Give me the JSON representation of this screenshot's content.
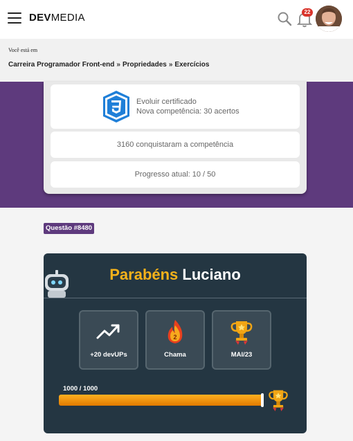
{
  "header": {
    "logo_bold": "DEV",
    "logo_light": "MEDIA",
    "notifications_count": "22"
  },
  "breadcrumb": {
    "label": "Você está em",
    "items": [
      "Carreira Programador Front-end",
      "Propriedades",
      "Exercícios"
    ],
    "separator": "»"
  },
  "competency": {
    "line1": "Evoluir certificado",
    "line2": "Nova competência: 30 acertos",
    "achievers": "3160 conquistaram a competência",
    "progress": "Progresso atual: 10 / 50"
  },
  "question": {
    "tag": "Questão #8480"
  },
  "congrats": {
    "word": "Parabéns",
    "name": "Luciano",
    "stats": [
      {
        "label": "+20 devUPs",
        "icon": "trending-up-icon"
      },
      {
        "label": "Chama",
        "icon": "flame-icon",
        "value": "2"
      },
      {
        "label": "MAI/23",
        "icon": "trophy-icon"
      }
    ],
    "progress_text": "1000 / 1000",
    "progress_fraction": 1.0
  },
  "colors": {
    "purple": "#5e3a7d",
    "card_dark": "#243642",
    "accent_gold": "#f6b21a",
    "badge_red": "#d9342b"
  }
}
